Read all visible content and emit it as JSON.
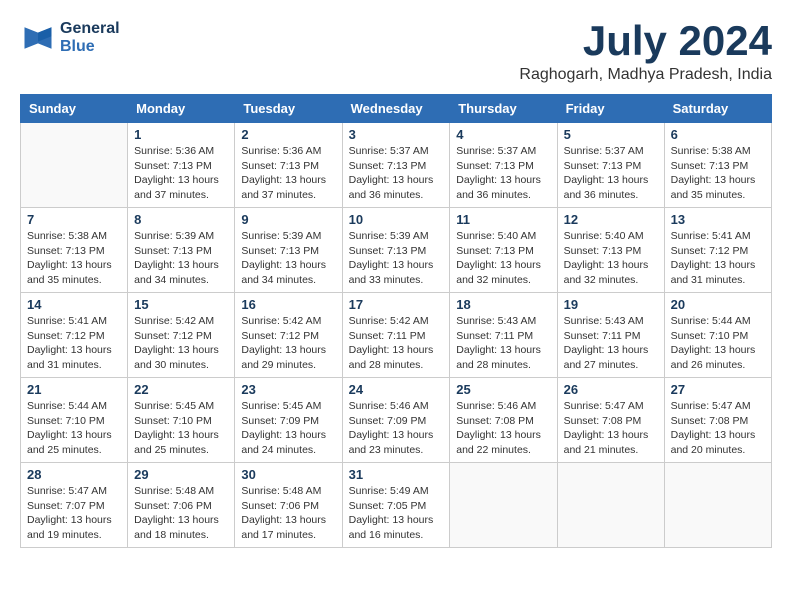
{
  "header": {
    "logo_line1": "General",
    "logo_line2": "Blue",
    "month": "July 2024",
    "location": "Raghogarh, Madhya Pradesh, India"
  },
  "weekdays": [
    "Sunday",
    "Monday",
    "Tuesday",
    "Wednesday",
    "Thursday",
    "Friday",
    "Saturday"
  ],
  "weeks": [
    [
      {
        "day": "",
        "info": ""
      },
      {
        "day": "1",
        "info": "Sunrise: 5:36 AM\nSunset: 7:13 PM\nDaylight: 13 hours\nand 37 minutes."
      },
      {
        "day": "2",
        "info": "Sunrise: 5:36 AM\nSunset: 7:13 PM\nDaylight: 13 hours\nand 37 minutes."
      },
      {
        "day": "3",
        "info": "Sunrise: 5:37 AM\nSunset: 7:13 PM\nDaylight: 13 hours\nand 36 minutes."
      },
      {
        "day": "4",
        "info": "Sunrise: 5:37 AM\nSunset: 7:13 PM\nDaylight: 13 hours\nand 36 minutes."
      },
      {
        "day": "5",
        "info": "Sunrise: 5:37 AM\nSunset: 7:13 PM\nDaylight: 13 hours\nand 36 minutes."
      },
      {
        "day": "6",
        "info": "Sunrise: 5:38 AM\nSunset: 7:13 PM\nDaylight: 13 hours\nand 35 minutes."
      }
    ],
    [
      {
        "day": "7",
        "info": "Sunrise: 5:38 AM\nSunset: 7:13 PM\nDaylight: 13 hours\nand 35 minutes."
      },
      {
        "day": "8",
        "info": "Sunrise: 5:39 AM\nSunset: 7:13 PM\nDaylight: 13 hours\nand 34 minutes."
      },
      {
        "day": "9",
        "info": "Sunrise: 5:39 AM\nSunset: 7:13 PM\nDaylight: 13 hours\nand 34 minutes."
      },
      {
        "day": "10",
        "info": "Sunrise: 5:39 AM\nSunset: 7:13 PM\nDaylight: 13 hours\nand 33 minutes."
      },
      {
        "day": "11",
        "info": "Sunrise: 5:40 AM\nSunset: 7:13 PM\nDaylight: 13 hours\nand 32 minutes."
      },
      {
        "day": "12",
        "info": "Sunrise: 5:40 AM\nSunset: 7:13 PM\nDaylight: 13 hours\nand 32 minutes."
      },
      {
        "day": "13",
        "info": "Sunrise: 5:41 AM\nSunset: 7:12 PM\nDaylight: 13 hours\nand 31 minutes."
      }
    ],
    [
      {
        "day": "14",
        "info": "Sunrise: 5:41 AM\nSunset: 7:12 PM\nDaylight: 13 hours\nand 31 minutes."
      },
      {
        "day": "15",
        "info": "Sunrise: 5:42 AM\nSunset: 7:12 PM\nDaylight: 13 hours\nand 30 minutes."
      },
      {
        "day": "16",
        "info": "Sunrise: 5:42 AM\nSunset: 7:12 PM\nDaylight: 13 hours\nand 29 minutes."
      },
      {
        "day": "17",
        "info": "Sunrise: 5:42 AM\nSunset: 7:11 PM\nDaylight: 13 hours\nand 28 minutes."
      },
      {
        "day": "18",
        "info": "Sunrise: 5:43 AM\nSunset: 7:11 PM\nDaylight: 13 hours\nand 28 minutes."
      },
      {
        "day": "19",
        "info": "Sunrise: 5:43 AM\nSunset: 7:11 PM\nDaylight: 13 hours\nand 27 minutes."
      },
      {
        "day": "20",
        "info": "Sunrise: 5:44 AM\nSunset: 7:10 PM\nDaylight: 13 hours\nand 26 minutes."
      }
    ],
    [
      {
        "day": "21",
        "info": "Sunrise: 5:44 AM\nSunset: 7:10 PM\nDaylight: 13 hours\nand 25 minutes."
      },
      {
        "day": "22",
        "info": "Sunrise: 5:45 AM\nSunset: 7:10 PM\nDaylight: 13 hours\nand 25 minutes."
      },
      {
        "day": "23",
        "info": "Sunrise: 5:45 AM\nSunset: 7:09 PM\nDaylight: 13 hours\nand 24 minutes."
      },
      {
        "day": "24",
        "info": "Sunrise: 5:46 AM\nSunset: 7:09 PM\nDaylight: 13 hours\nand 23 minutes."
      },
      {
        "day": "25",
        "info": "Sunrise: 5:46 AM\nSunset: 7:08 PM\nDaylight: 13 hours\nand 22 minutes."
      },
      {
        "day": "26",
        "info": "Sunrise: 5:47 AM\nSunset: 7:08 PM\nDaylight: 13 hours\nand 21 minutes."
      },
      {
        "day": "27",
        "info": "Sunrise: 5:47 AM\nSunset: 7:08 PM\nDaylight: 13 hours\nand 20 minutes."
      }
    ],
    [
      {
        "day": "28",
        "info": "Sunrise: 5:47 AM\nSunset: 7:07 PM\nDaylight: 13 hours\nand 19 minutes."
      },
      {
        "day": "29",
        "info": "Sunrise: 5:48 AM\nSunset: 7:06 PM\nDaylight: 13 hours\nand 18 minutes."
      },
      {
        "day": "30",
        "info": "Sunrise: 5:48 AM\nSunset: 7:06 PM\nDaylight: 13 hours\nand 17 minutes."
      },
      {
        "day": "31",
        "info": "Sunrise: 5:49 AM\nSunset: 7:05 PM\nDaylight: 13 hours\nand 16 minutes."
      },
      {
        "day": "",
        "info": ""
      },
      {
        "day": "",
        "info": ""
      },
      {
        "day": "",
        "info": ""
      }
    ]
  ]
}
